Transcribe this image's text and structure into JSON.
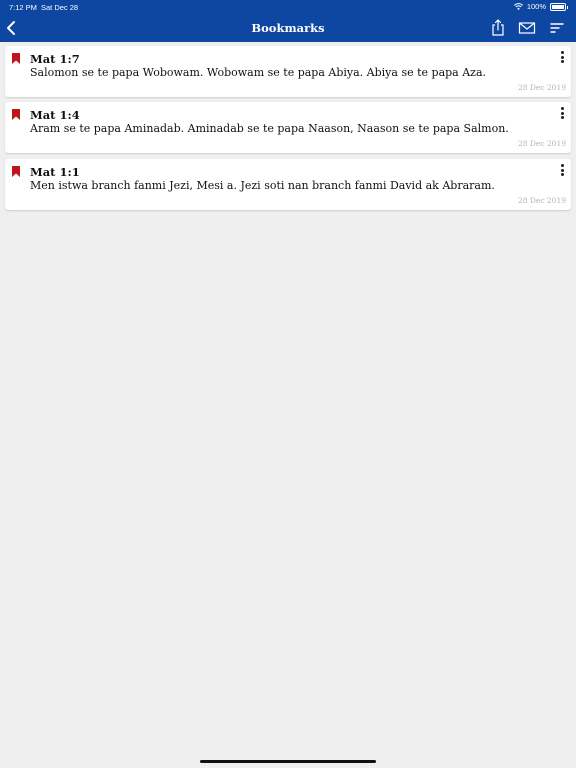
{
  "status_bar": {
    "time": "7:12 PM",
    "date": "Sat Dec 28",
    "battery": "100%"
  },
  "header": {
    "title": "Bookmarks"
  },
  "bookmarks": [
    {
      "reference": "Mat 1:7",
      "text": "Salomon se te papa Wobowam. Wobowam se te papa Abiya. Abiya se te papa Aza.",
      "date": "28 Dec 2019"
    },
    {
      "reference": "Mat 1:4",
      "text": "Aram se te papa Aminadab. Aminadab se te papa Naason, Naason se te papa Salmon.",
      "date": "28 Dec 2019"
    },
    {
      "reference": "Mat 1:1",
      "text": "Men istwa branch fanmi Jezi, Mesi a. Jezi soti nan branch fanmi David ak Abraram.",
      "date": "28 Dec 2019"
    }
  ],
  "colors": {
    "nav_bar": "#0d47a1",
    "bookmark_icon": "#c0161b",
    "background": "#efefef"
  },
  "icons": [
    "back-icon",
    "share-icon",
    "mail-icon",
    "sort-icon",
    "bookmark-icon",
    "more-options-icon",
    "wifi-icon",
    "battery-icon"
  ]
}
